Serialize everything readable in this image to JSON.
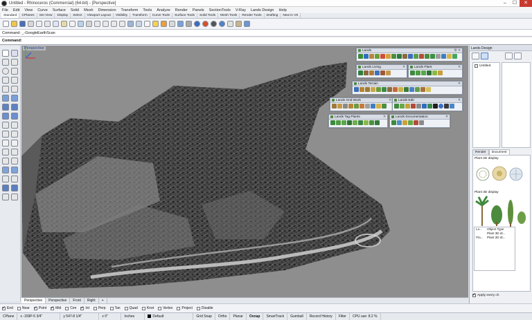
{
  "window": {
    "title": "Untitled - Rhinoceros (Commercial) (64-bit) - [Perspective]"
  },
  "menu": [
    "File",
    "Edit",
    "View",
    "Curve",
    "Surface",
    "Solid",
    "Mesh",
    "Dimension",
    "Transform",
    "Tools",
    "Analyze",
    "Render",
    "Panels",
    "SectionTools",
    "V-Ray",
    "Lands Design",
    "Help"
  ],
  "toolbar_tabs": [
    "Standard",
    "CPlanes",
    "Set View",
    "Display",
    "Select",
    "Viewport Layout",
    "Visibility",
    "Transform",
    "Curve Tools",
    "Surface Tools",
    "Solid Tools",
    "Mesh Tools",
    "Render Tools",
    "Drafting",
    "New in V5"
  ],
  "command": {
    "history": "Command: _-GoogleEarthScan",
    "label": "Command:",
    "value": ""
  },
  "viewport": {
    "label": "Perspective"
  },
  "panels": {
    "lands": "Lands",
    "living": "Lands Living",
    "plant": "Lands Plant",
    "terrain": "Lands Terrain",
    "grid_work": "Lands Grid Work",
    "edit": "Lands Edit",
    "tag_plants": "Lands Tag Plants",
    "documentation": "Lands Documentation"
  },
  "view_tabs": [
    "Perspective",
    "Perspective",
    "Front",
    "Right",
    "+"
  ],
  "osnaps": [
    {
      "label": "End",
      "checked": true
    },
    {
      "label": "Near",
      "checked": false
    },
    {
      "label": "Point",
      "checked": true
    },
    {
      "label": "Mid",
      "checked": true
    },
    {
      "label": "Cen",
      "checked": false
    },
    {
      "label": "Int",
      "checked": true
    },
    {
      "label": "Perp",
      "checked": false
    },
    {
      "label": "Tan",
      "checked": false
    },
    {
      "label": "Quad",
      "checked": false
    },
    {
      "label": "Knot",
      "checked": false
    },
    {
      "label": "Vertex",
      "checked": false
    },
    {
      "label": "Project",
      "checked": false
    },
    {
      "label": "Disable",
      "checked": false
    }
  ],
  "status": {
    "cplane": "CPlane",
    "x": "x -159P-5 3/4\"",
    "y": "y 547-8 1/4\"",
    "z": "z 0\"",
    "units": "Inches",
    "layer": "Default",
    "grid_snap": "Grid Snap",
    "ortho": "Ortho",
    "planar": "Planar",
    "osnap": "Osnap",
    "smarttrack": "SmartTrack",
    "gumball": "Gumball",
    "record_history": "Record History",
    "filter": "Filter",
    "cpu": "CPU use: 8.2 %"
  },
  "right_panel": {
    "title": "Lands Design",
    "tree_item": "Untitled",
    "tabs": [
      "Render",
      "Document"
    ],
    "plant_2d": "Plant 2D display",
    "plant_3d": "Plant 3D display",
    "props": [
      {
        "k": "La...",
        "v": "Object Type"
      },
      {
        "k": "",
        "v": "Plant 3D dr..."
      },
      {
        "k": "Pla...",
        "v": "Plant 2D dr..."
      }
    ],
    "apply": "Apply every ch"
  },
  "colors": {
    "viewport_bg": "#8e8e8e",
    "close": "#c83a2e",
    "accent": "#1a3c8c"
  }
}
